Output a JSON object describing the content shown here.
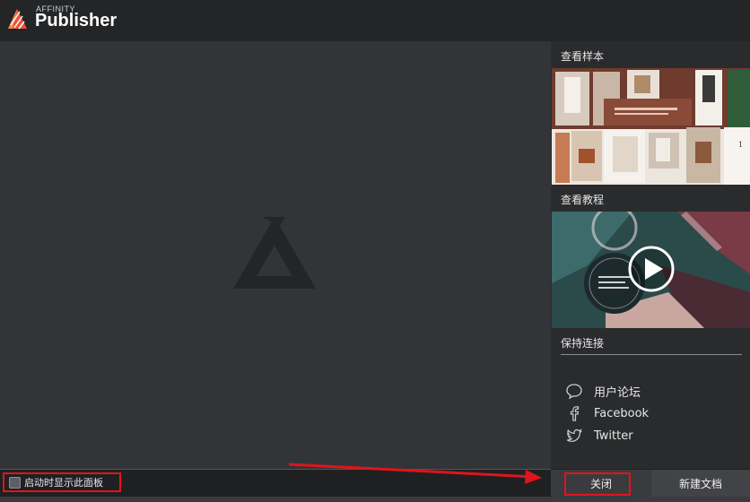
{
  "app": {
    "brand_small": "AFFINITY",
    "brand_name": "Publisher",
    "accent_color": "#e0141b"
  },
  "panel": {
    "samples_title": "查看样本",
    "tutorials_title": "查看教程",
    "connect_title": "保持连接",
    "links": [
      {
        "label": "用户论坛",
        "icon": "forum-bubble-icon"
      },
      {
        "label": "Facebook",
        "icon": "facebook-icon"
      },
      {
        "label": "Twitter",
        "icon": "twitter-icon"
      }
    ],
    "samples_page_number": "1"
  },
  "footer": {
    "show_on_startup_label": "启动时显示此面板",
    "show_on_startup_checked": false,
    "close_label": "关闭",
    "new_document_label": "新建文档"
  }
}
